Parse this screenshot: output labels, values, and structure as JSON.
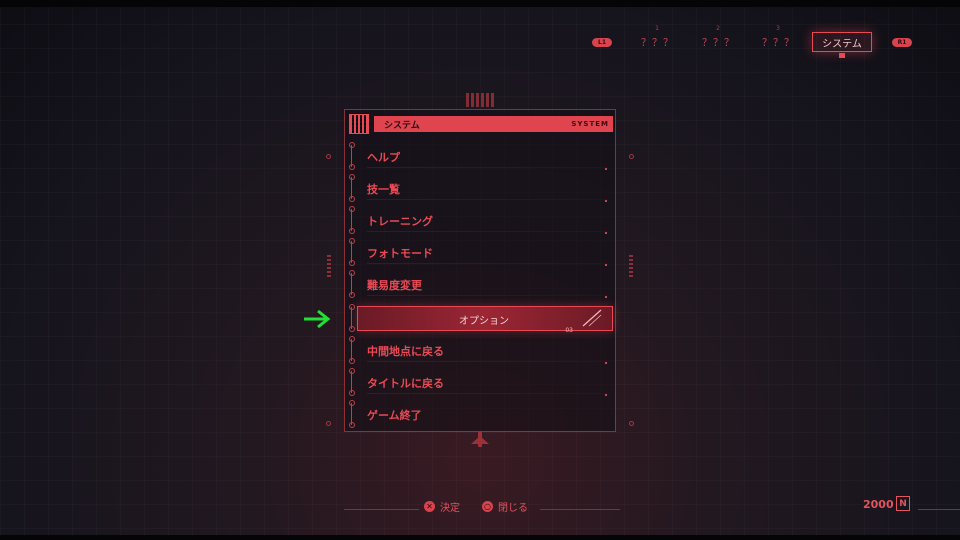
{
  "tabs": {
    "left_bumper": "L1",
    "right_bumper": "R1",
    "items": [
      {
        "num": "1",
        "label": "？？？"
      },
      {
        "num": "2",
        "label": "？？？"
      },
      {
        "num": "3",
        "label": "？？？"
      }
    ],
    "active": {
      "label": "システム",
      "sub": "5"
    }
  },
  "menu": {
    "header": {
      "title": "システム",
      "code": "SYSTEM"
    },
    "items": [
      {
        "label": "ヘルプ"
      },
      {
        "label": "技一覧"
      },
      {
        "label": "トレーニング"
      },
      {
        "label": "フォトモード"
      },
      {
        "label": "難易度変更"
      },
      {
        "label": "オプション",
        "selected": true,
        "tag": "03"
      },
      {
        "label": "中間地点に戻る"
      },
      {
        "label": "タイトルに戻る"
      },
      {
        "label": "ゲーム終了"
      }
    ],
    "selected_index": 5
  },
  "pointer": {
    "icon": "green-arrow-icon",
    "color": "#22e033"
  },
  "footer": {
    "confirm": {
      "symbol": "✕",
      "label": "決定"
    },
    "close": {
      "symbol": "○",
      "label": "閉じる"
    }
  },
  "currency": {
    "amount": "2000",
    "icon_glyph": "N"
  },
  "colors": {
    "accent": "#e84a55",
    "background": "#16141d"
  }
}
